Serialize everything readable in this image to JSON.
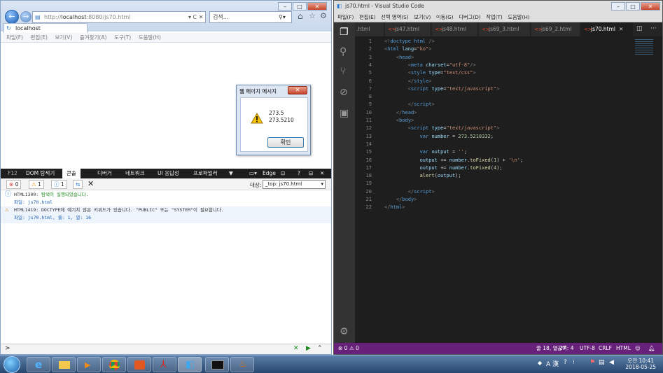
{
  "ie": {
    "url_prefix": "http://",
    "url_host": "localhost",
    "url_path": ":8080/js70.html",
    "search_placeholder": "검색...",
    "tab_title": "localhost",
    "menu": [
      "파일(F)",
      "편집(E)",
      "보기(V)",
      "즐겨찾기(A)",
      "도구(T)",
      "도움말(H)"
    ],
    "dialog": {
      "title": "웹 페이지 메시지",
      "line1": "273.5",
      "line2": "273.5210",
      "ok_label": "확인"
    },
    "devtools": {
      "tabs": [
        "F12",
        "DOM 탐색기",
        "콘솔",
        "디버거",
        "네트워크",
        "UI 응답성",
        "프로파일러"
      ],
      "active_tab": "콘솔",
      "emulation_label": "Edge",
      "error_count": "0",
      "warning_count": "1",
      "info_count": "1",
      "target_label": "대상:",
      "target_value": "_top: js70.html",
      "messages": [
        {
          "code": "HTML1300:",
          "text": "탐색이 실행되었습니다.",
          "file": "파일: js70.html"
        },
        {
          "code": "HTML1419:",
          "text": "DOCTYPE에 예기치 않은 키워드가 있습니다. \"PUBLIC\" 또는 \"SYSTEM\"이 필요합니다.",
          "file": "파일: js70.html, 줄: 1, 열: 16"
        }
      ],
      "prompt": ">"
    }
  },
  "vscode": {
    "title": "js70.html - Visual Studio Code",
    "menu": [
      "파일(F)",
      "편집(E)",
      "선택 영역(S)",
      "보기(V)",
      "이동(G)",
      "디버그(D)",
      "작업(T)",
      "도움말(H)"
    ],
    "tabs": [
      ".html",
      "js47.html",
      "js48.html",
      "js69_3.html",
      "js69_2.html",
      "js70.html"
    ],
    "active_tab": "js70.html",
    "line_numbers": [
      "1",
      "2",
      "3",
      "4",
      "5",
      "6",
      "7",
      "8",
      "9",
      "10",
      "11",
      "12",
      "13",
      "14",
      "15",
      "16",
      "17",
      "18",
      "19",
      "20",
      "21",
      "22"
    ],
    "status": {
      "problems": "0",
      "warnings": "0",
      "position": "줄 18, 열 27",
      "spaces": "공백: 4",
      "encoding": "UTF-8",
      "eol": "CRLF",
      "language": "HTML"
    }
  },
  "taskbar": {
    "ime": "A 漢",
    "time": "오전 10:41",
    "date": "2018-05-25"
  }
}
